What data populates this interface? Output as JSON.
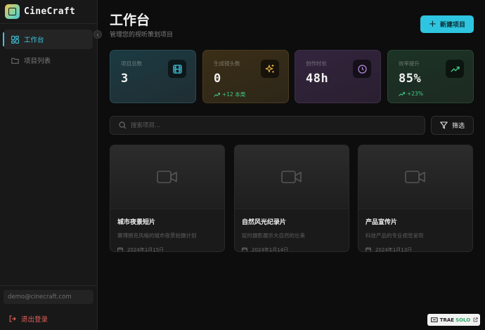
{
  "app": {
    "name": "CineCraft"
  },
  "sidebar": {
    "items": [
      {
        "label": "工作台",
        "icon": "grid-icon",
        "active": true
      },
      {
        "label": "项目列表",
        "icon": "folder-icon",
        "active": false
      }
    ],
    "user_email": "demo@cinecraft.com",
    "logout_label": "退出登录"
  },
  "header": {
    "title": "工作台",
    "subtitle": "管理您的视听策划项目",
    "new_button_label": "新建项目"
  },
  "stats": [
    {
      "label": "项目总数",
      "value": "3",
      "icon": "film-icon",
      "accent": "#3fc6de"
    },
    {
      "label": "生成镜头数",
      "value": "0",
      "delta": "+12 本周",
      "icon": "sparkles-icon",
      "accent": "#f2b84b"
    },
    {
      "label": "创作时长",
      "value": "48h",
      "icon": "clock-icon",
      "accent": "#b98ce0"
    },
    {
      "label": "效率提升",
      "value": "85%",
      "delta": "+23%",
      "icon": "trending-up-icon",
      "accent": "#3fd08a"
    }
  ],
  "search": {
    "placeholder": "搜索项目..."
  },
  "filter_label": "筛选",
  "projects": [
    {
      "title": "城市夜景短片",
      "description": "赛博朋克风格的城市夜景拍摄计划",
      "date": "2024年1月15日"
    },
    {
      "title": "自然风光纪录片",
      "description": "延时摄影展示大自然的壮美",
      "date": "2024年1月14日"
    },
    {
      "title": "产品宣传片",
      "description": "科技产品的专业视觉呈现",
      "date": "2024年1月13日"
    }
  ],
  "watermark": {
    "text_a": "TRAE",
    "text_b": "SOLO"
  }
}
